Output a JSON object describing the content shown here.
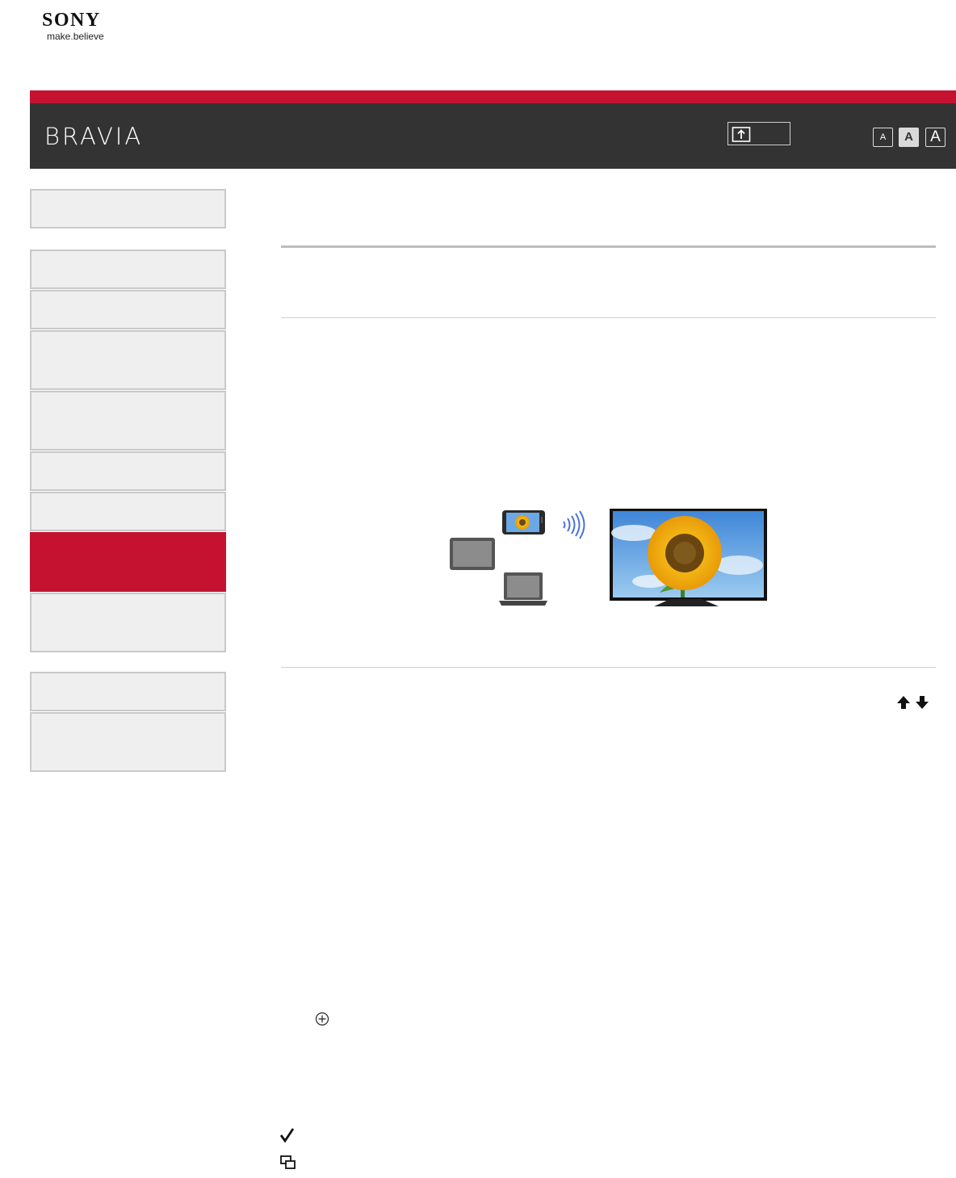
{
  "brand": {
    "company": "SONY",
    "tagline_part1": "make",
    "tagline_dot": ".",
    "tagline_part2": "believe",
    "product": "BRAVIA",
    "accent_color": "#c41230",
    "header_color": "#333333"
  },
  "toolbar": {
    "upload_icon": "upload-icon",
    "font_sizes": [
      {
        "label": "A",
        "size": "small"
      },
      {
        "label": "A",
        "size": "medium",
        "selected": true
      },
      {
        "label": "A",
        "size": "large"
      }
    ]
  },
  "sidebar": {
    "items": [
      {
        "label": ""
      },
      {
        "label": ""
      },
      {
        "label": ""
      },
      {
        "label": ""
      },
      {
        "label": ""
      },
      {
        "label": ""
      },
      {
        "label": ""
      },
      {
        "label": "",
        "active": true
      },
      {
        "label": ""
      },
      {
        "label": ""
      },
      {
        "label": ""
      }
    ]
  },
  "content": {
    "illustration_icons": [
      "smartphone-icon",
      "tablet-icon",
      "laptop-icon",
      "wireless-signal-icon",
      "tv-sunflower-icon"
    ],
    "nav_icons": [
      "arrow-up-icon",
      "arrow-down-icon"
    ],
    "bullet_icons": [
      "circle-plus-icon",
      "checkmark-icon",
      "screen-mirroring-icon"
    ]
  }
}
